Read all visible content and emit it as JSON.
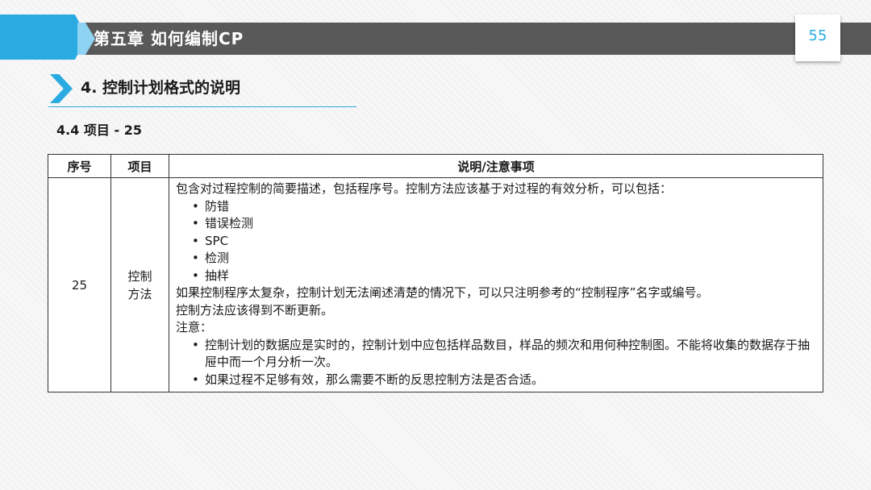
{
  "header": {
    "chapter_title": "第五章  如何编制CP",
    "page_number": "55"
  },
  "section": {
    "title": "4. 控制计划格式的说明",
    "subtitle": "4.4 项目 - 25"
  },
  "table": {
    "headers": [
      "序号",
      "项目",
      "说明/注意事项"
    ],
    "row": {
      "number": "25",
      "item_lines": [
        "控制",
        "方法"
      ],
      "description": {
        "intro": "包含对过程控制的简要描述，包括程序号。控制方法应该基于对过程的有效分析，可以包括：",
        "methods": [
          "防错",
          "错误检测",
          "SPC",
          "检测",
          "抽样"
        ],
        "line_complex": "如果控制程序太复杂，控制计划无法阐述清楚的情况下，可以只注明参考的“控制程序”名字或编号。",
        "line_update": "控制方法应该得到不断更新。",
        "note_label": "注意：",
        "notes": [
          "控制计划的数据应是实时的，控制计划中应包括样品数目，样品的频次和用何种控制图。不能将收集的数据存于抽屉中而一个月分析一次。",
          "如果过程不足够有效，那么需要不断的反思控制方法是否合适。"
        ]
      }
    }
  },
  "colors": {
    "accent": "#29abe2",
    "header_bar": "#595959"
  }
}
